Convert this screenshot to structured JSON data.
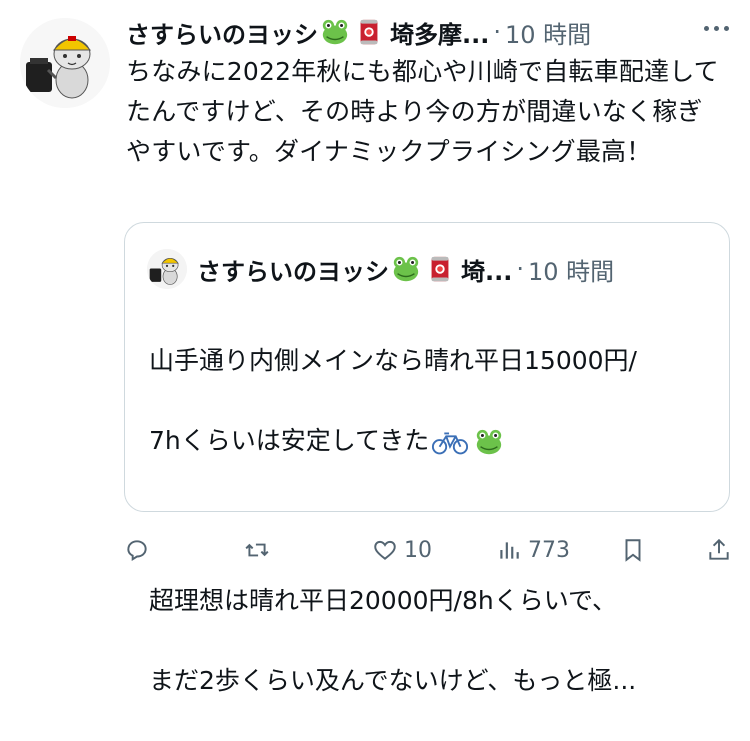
{
  "tweet": {
    "author": "さすらいのヨッシ",
    "author_suffix": "埼多摩...",
    "separator": "·",
    "time": "10 時間",
    "text": "ちなみに2022年秋にも都心や川崎で自転車配達してたんですけど、その時より今の方が間違いなく稼ぎやすいです。ダイナミックプライシング最高！"
  },
  "quote": {
    "author": "さすらいのヨッシ",
    "author_suffix": "埼...",
    "separator": "·",
    "time": "10 時間",
    "line1": "山手通り内側メインなら晴れ平日15000円/",
    "line2": "7hくらいは安定してきた",
    "line3": "超理想は晴れ平日20000円/8hくらいで、",
    "line4": "まだ2歩くらい及んでないけど、もっと極..."
  },
  "actions": {
    "reply_icon": "reply-icon",
    "retweet_icon": "retweet-icon",
    "like_icon": "heart-icon",
    "like_count": "10",
    "views_icon": "views-icon",
    "views_count": "773",
    "bookmark_icon": "bookmark-icon",
    "share_icon": "share-icon"
  },
  "colors": {
    "text": "#0f1419",
    "muted": "#536471",
    "border": "#cfd9de",
    "frog": "#6cc24a",
    "can": "#c8202f"
  }
}
